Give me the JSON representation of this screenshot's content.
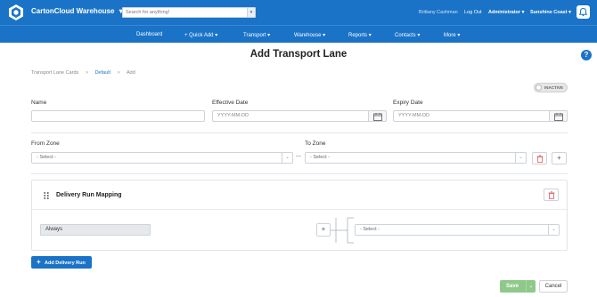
{
  "header": {
    "app_name": "CartonCloud Warehouse",
    "app_caret": "▾",
    "search_placeholder": "Search for anything!",
    "user_name": "Brittany Cashman",
    "logout": "Log Out",
    "role": "Administrator",
    "region": "Sunshine Coast"
  },
  "nav": {
    "items": [
      "Dashboard",
      "+ Quick Add",
      "Transport",
      "Warehouse",
      "Reports",
      "Contacts",
      "More"
    ],
    "caret": "▾"
  },
  "page": {
    "title": "Add Transport Lane",
    "help": "?"
  },
  "breadcrumb": {
    "items": [
      "Transport Lane Cards",
      "Default",
      "Add"
    ],
    "separator": ">"
  },
  "status_toggle": {
    "label": "INACTIVE",
    "active": false
  },
  "form": {
    "name_label": "Name",
    "name_value": "",
    "effective_label": "Effective Date",
    "effective_placeholder": "YYYY-MM-DD",
    "expiry_label": "Expiry Date",
    "expiry_placeholder": "YYYY-MM-DD",
    "from_zone_label": "From Zone",
    "from_zone_value": "- Select -",
    "to_zone_label": "To Zone",
    "to_zone_value": "- Select -",
    "zone_separator": "—"
  },
  "delivery_card": {
    "title": "Delivery Run Mapping",
    "condition": "Always",
    "run_value": "- Select -"
  },
  "actions": {
    "add_delivery_run": "Add Delivery Run",
    "save": "Save",
    "cancel": "Cancel"
  },
  "colors": {
    "brand": "#1a73c7",
    "save": "#8fc98a",
    "danger": "#e25a5a"
  }
}
